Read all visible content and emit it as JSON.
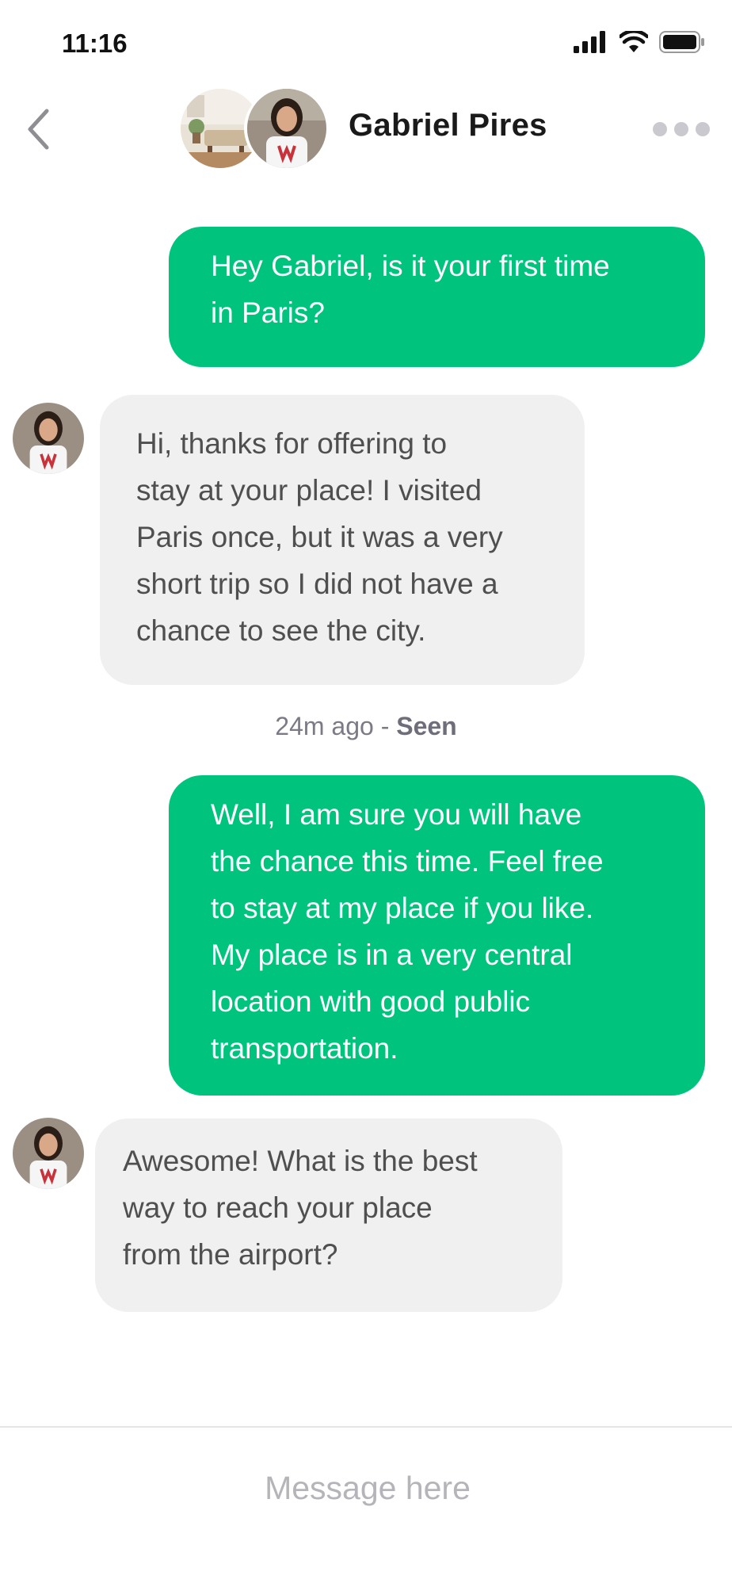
{
  "status_bar": {
    "time": "11:16"
  },
  "header": {
    "contact_name": "Gabriel Pires"
  },
  "messages": [
    {
      "direction": "sent",
      "lines": [
        "Hey Gabriel, is it your first time",
        "in Paris?"
      ]
    },
    {
      "direction": "received",
      "lines": [
        "Hi, thanks for offering to",
        "stay at your place! I visited",
        "Paris once, but it was a very",
        "short trip so I did not have a",
        "chance to see the city."
      ]
    },
    {
      "direction": "sent",
      "lines": [
        "Well, I am sure you will have",
        "the chance this time. Feel free",
        "to stay at my place if you like.",
        "My place is in a very central",
        "location with good public",
        "transportation."
      ]
    },
    {
      "direction": "received",
      "lines": [
        "Awesome! What is the best",
        "way to reach your place",
        "from the airport?"
      ]
    }
  ],
  "receipt": {
    "time_ago": "24m ago",
    "separator": " - ",
    "status": "Seen"
  },
  "composer": {
    "placeholder": "Message here"
  },
  "colors": {
    "sent_bubble": "#00c47d",
    "received_bubble": "#f0f0f0",
    "background": "#ffffff"
  },
  "icons": [
    "signal-icon",
    "wifi-icon",
    "battery-icon",
    "back-chevron-icon",
    "more-dots-icon"
  ]
}
